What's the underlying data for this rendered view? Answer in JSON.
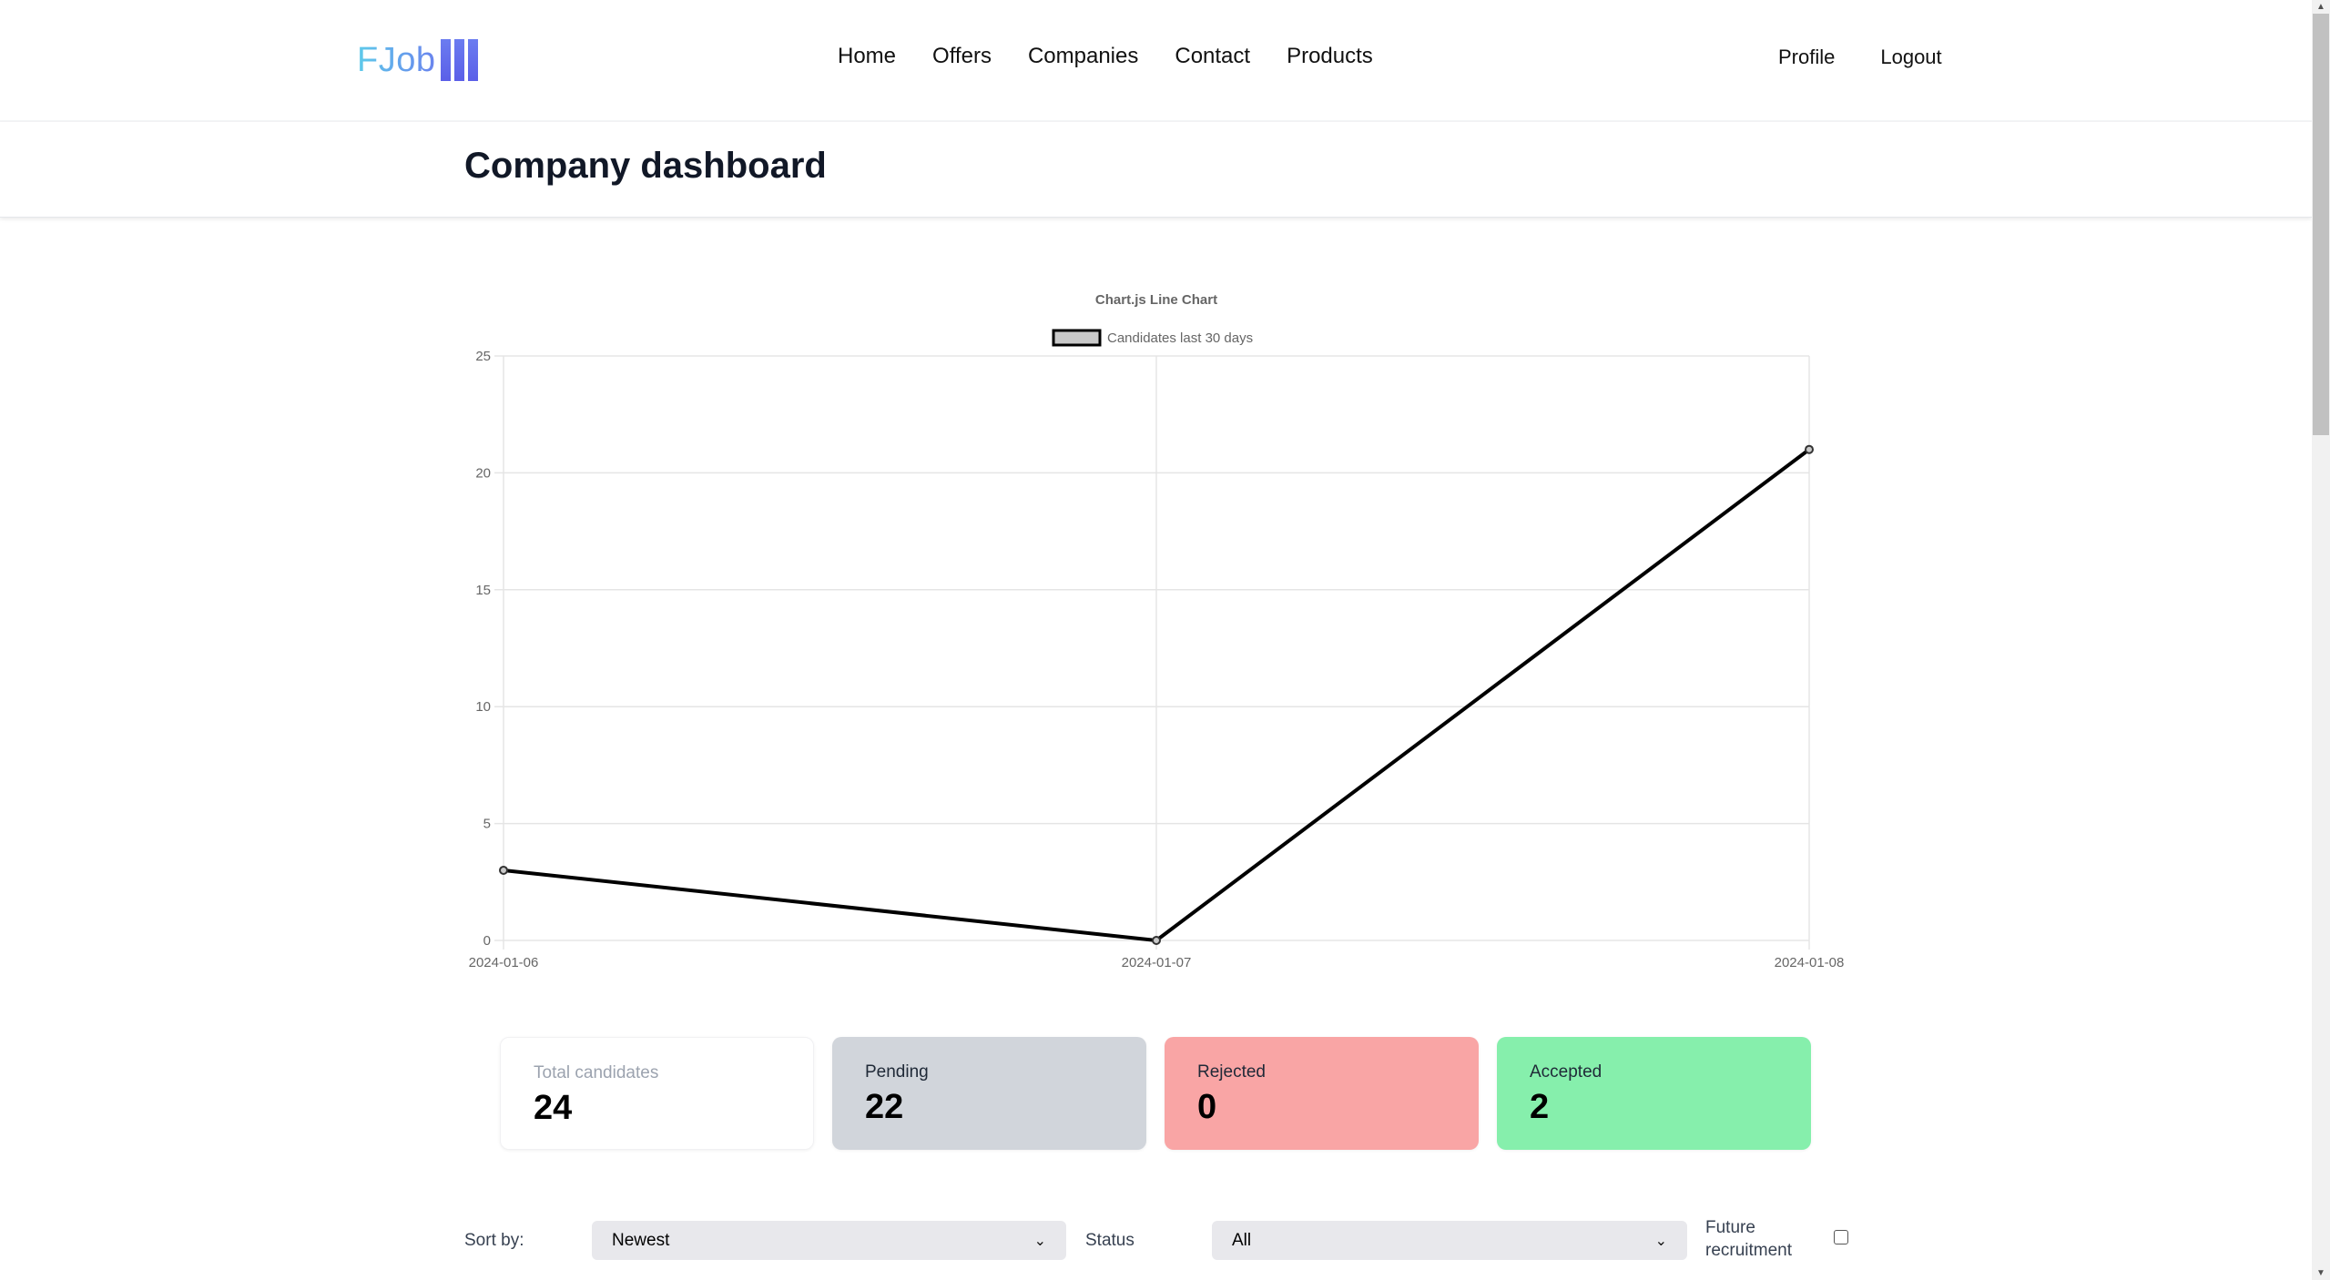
{
  "navbar": {
    "logo_text": "FJob",
    "links": [
      {
        "label": "Home"
      },
      {
        "label": "Offers"
      },
      {
        "label": "Companies"
      },
      {
        "label": "Contact"
      },
      {
        "label": "Products"
      }
    ],
    "right_links": [
      {
        "label": "Profile"
      },
      {
        "label": "Logout"
      }
    ]
  },
  "page": {
    "title": "Company dashboard"
  },
  "chart_data": {
    "type": "line",
    "title": "Chart.js Line Chart",
    "legend": {
      "label": "Candidates last 30 days",
      "position": "top"
    },
    "categories": [
      "2024-01-06",
      "2024-01-07",
      "2024-01-08"
    ],
    "series": [
      {
        "name": "Candidates last 30 days",
        "values": [
          3,
          0,
          21
        ]
      }
    ],
    "ylim": [
      0,
      25
    ],
    "yticks": [
      0,
      5,
      10,
      15,
      20,
      25
    ],
    "xlabel": "",
    "ylabel": "",
    "grid": true,
    "colors": {
      "line": "#000000",
      "point_fill": "#c9c9c9",
      "grid": "#e5e5e5",
      "text": "#666666"
    }
  },
  "stats": [
    {
      "label": "Total candidates",
      "value": "24",
      "color": "#ffffff"
    },
    {
      "label": "Pending",
      "value": "22",
      "color": "#d1d5db"
    },
    {
      "label": "Rejected",
      "value": "0",
      "color": "#f9a5a5"
    },
    {
      "label": "Accepted",
      "value": "2",
      "color": "#86efac"
    }
  ],
  "filters": {
    "sort_label": "Sort by:",
    "sort_value": "Newest",
    "status_label": "Status",
    "status_value": "All",
    "future_label": "Future recruitment",
    "future_checked": false
  }
}
